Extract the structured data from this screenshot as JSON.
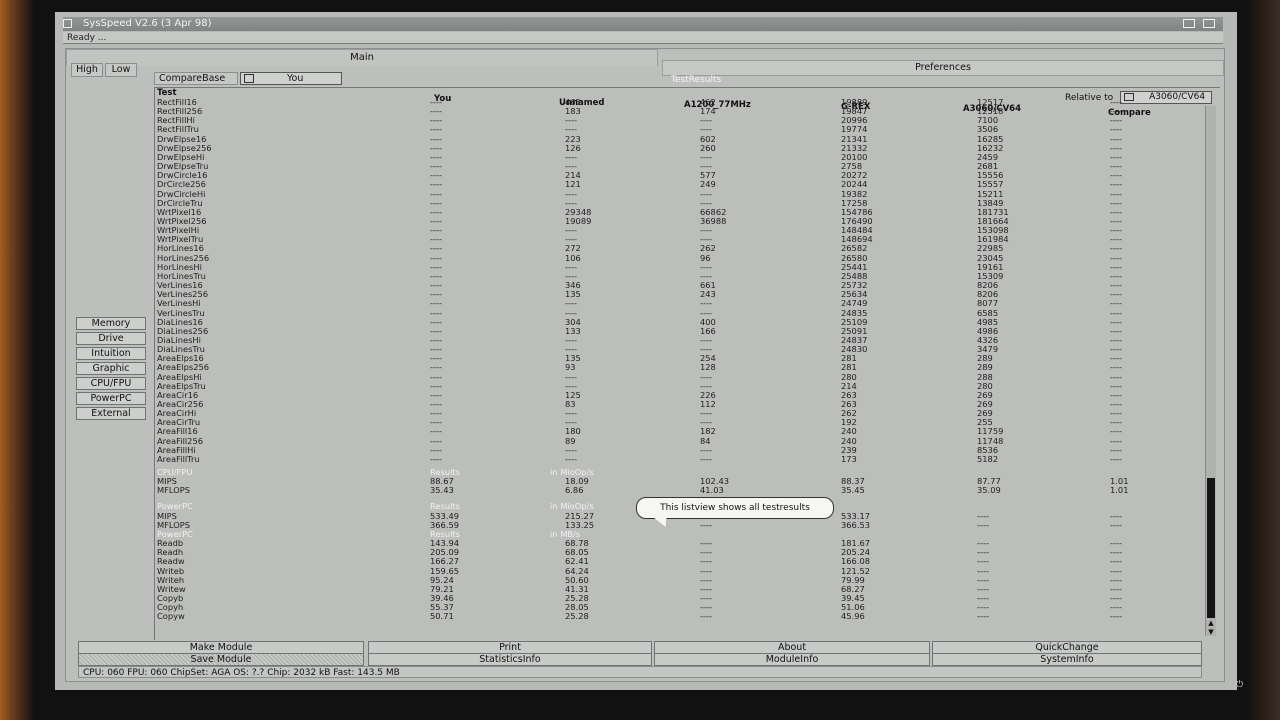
{
  "app": {
    "title": "SysSpeed  V2.6 (3 Apr 98)",
    "status_top": "Ready ...",
    "tabs": {
      "main": "Main",
      "preferences": "Preferences"
    },
    "res_tabs": [
      "High",
      "Low"
    ],
    "side_menu": [
      "Memory",
      "Drive",
      "Intuition",
      "Graphic",
      "CPU/FPU",
      "PowerPC",
      "External"
    ],
    "compare_base_label": "CompareBase",
    "compare_base_value": "You",
    "testresults_label": "TestResults",
    "relative_to_label": "Relative to",
    "relative_to_value": "A3060/CV64",
    "tooltip": "This listview shows all testresults",
    "bottom_buttons_row1": [
      "Make Module",
      "Print",
      "About",
      "QuickChange"
    ],
    "bottom_buttons_row2": [
      "Save Module",
      "StatisticsInfo",
      "ModuleInfo",
      "SystemInfo"
    ],
    "statusbar": "CPU: 060  FPU: 060  ChipSet: AGA  OS: ?.?  Chip: 2032 kB  Fast: 143.5 MB"
  },
  "table": {
    "headers": {
      "test": "Test",
      "c1": "You",
      "c2": "Unnamed",
      "c3": "A1200_77MHz",
      "c4": "G-REX",
      "c5": "A3060/CV64",
      "c6": "Compare"
    },
    "rows": [
      [
        "RectFill16",
        "----",
        "465",
        "462",
        "19889",
        "12517",
        "----"
      ],
      [
        "RectFill256",
        "----",
        "183",
        "174",
        "19847",
        "12518",
        "----"
      ],
      [
        "RectFillHi",
        "----",
        "----",
        "----",
        "20996",
        "7100",
        "----"
      ],
      [
        "RectFillTru",
        "----",
        "----",
        "----",
        "19774",
        "3506",
        "----"
      ],
      [
        "DrwElpse16",
        "----",
        "223",
        "602",
        "21341",
        "16285",
        "----"
      ],
      [
        "DrwElpse256",
        "----",
        "126",
        "260",
        "21332",
        "16232",
        "----"
      ],
      [
        "DrwElpseHi",
        "----",
        "----",
        "----",
        "20100",
        "2459",
        "----"
      ],
      [
        "DrwElpseTru",
        "----",
        "----",
        "----",
        "2758",
        "2681",
        "----"
      ],
      [
        "DrwCircle16",
        "----",
        "214",
        "577",
        "20272",
        "15556",
        "----"
      ],
      [
        "DrCircle256",
        "----",
        "121",
        "249",
        "20244",
        "15557",
        "----"
      ],
      [
        "DrwCircleHi",
        "----",
        "----",
        "----",
        "19382",
        "15211",
        "----"
      ],
      [
        "DrCircleTru",
        "----",
        "----",
        "----",
        "17258",
        "13849",
        "----"
      ],
      [
        "WrtPixel16",
        "----",
        "29348",
        "66862",
        "154786",
        "181731",
        "----"
      ],
      [
        "WrtPixel256",
        "----",
        "19089",
        "36988",
        "176490",
        "181664",
        "----"
      ],
      [
        "WrtPixelHi",
        "----",
        "----",
        "----",
        "148484",
        "153098",
        "----"
      ],
      [
        "WrtPixelTru",
        "----",
        "----",
        "----",
        "148694",
        "161984",
        "----"
      ],
      [
        "HorLines16",
        "----",
        "272",
        "262",
        "26582",
        "22985",
        "----"
      ],
      [
        "HorLines256",
        "----",
        "106",
        "96",
        "26580",
        "23045",
        "----"
      ],
      [
        "HorLinesHi",
        "----",
        "----",
        "----",
        "25441",
        "19161",
        "----"
      ],
      [
        "HorLinesTru",
        "----",
        "----",
        "----",
        "25488",
        "15309",
        "----"
      ],
      [
        "VerLines16",
        "----",
        "346",
        "661",
        "25732",
        "8206",
        "----"
      ],
      [
        "VerLines256",
        "----",
        "135",
        "243",
        "25634",
        "8206",
        "----"
      ],
      [
        "VerLinesHi",
        "----",
        "----",
        "----",
        "24749",
        "8077",
        "----"
      ],
      [
        "VerLinesTru",
        "----",
        "----",
        "----",
        "24835",
        "6585",
        "----"
      ],
      [
        "DiaLines16",
        "----",
        "304",
        "400",
        "25109",
        "4985",
        "----"
      ],
      [
        "DiaLines256",
        "----",
        "133",
        "166",
        "25091",
        "4986",
        "----"
      ],
      [
        "DiaLinesHi",
        "----",
        "----",
        "----",
        "24837",
        "4326",
        "----"
      ],
      [
        "DiaLinesTru",
        "----",
        "----",
        "----",
        "24830",
        "3479",
        "----"
      ],
      [
        "AreaElps16",
        "----",
        "135",
        "254",
        "281",
        "289",
        "----"
      ],
      [
        "AreaElps256",
        "----",
        "93",
        "128",
        "281",
        "289",
        "----"
      ],
      [
        "AreaElpsHi",
        "----",
        "----",
        "----",
        "280",
        "288",
        "----"
      ],
      [
        "AreaElpsTru",
        "----",
        "----",
        "----",
        "214",
        "280",
        "----"
      ],
      [
        "AreaCir16",
        "----",
        "125",
        "226",
        "263",
        "269",
        "----"
      ],
      [
        "AreaCir256",
        "----",
        "83",
        "112",
        "263",
        "269",
        "----"
      ],
      [
        "AreaCirHi",
        "----",
        "----",
        "----",
        "262",
        "269",
        "----"
      ],
      [
        "AreaCirTru",
        "----",
        "----",
        "----",
        "192",
        "255",
        "----"
      ],
      [
        "AreaFill16",
        "----",
        "180",
        "182",
        "240",
        "11759",
        "----"
      ],
      [
        "AreaFill256",
        "----",
        "89",
        "84",
        "240",
        "11748",
        "----"
      ],
      [
        "AreaFillHi",
        "----",
        "----",
        "----",
        "239",
        "8536",
        "----"
      ],
      [
        "AreaFillTru",
        "----",
        "----",
        "----",
        "173",
        "5182",
        "----"
      ]
    ],
    "sections": [
      {
        "title": "CPU/FPU",
        "results": "Results",
        "unit": "in MioOp/s",
        "rows": [
          [
            "MIPS",
            "88.67",
            "18.09",
            "102.43",
            "88.37",
            "87.77",
            "1.01"
          ],
          [
            "MFLOPS",
            "35.43",
            "6.86",
            "41.03",
            "35.45",
            "35.09",
            "1.01"
          ]
        ]
      },
      {
        "title": "PowerPC",
        "results": "Results",
        "unit": "in MioOp/s",
        "rows": [
          [
            "MIPS",
            "533.49",
            "215.27",
            "----",
            "533.17",
            "----",
            "----"
          ],
          [
            "MFLOPS",
            "366.59",
            "133.25",
            "----",
            "366.53",
            "----",
            "----"
          ]
        ]
      },
      {
        "title": "PowerPC",
        "results": "Results",
        "unit": "in MB/s",
        "rows": [
          [
            "Readb",
            "143.94",
            "68.78",
            "----",
            "181.67",
            "----",
            "----"
          ],
          [
            "Readh",
            "205.09",
            "68.05",
            "----",
            "205.24",
            "----",
            "----"
          ],
          [
            "Readw",
            "166.27",
            "62.41",
            "----",
            "166.08",
            "----",
            "----"
          ],
          [
            "Writeb",
            "159.65",
            "64.24",
            "----",
            "121.52",
            "----",
            "----"
          ],
          [
            "Writeh",
            "95.24",
            "50.60",
            "----",
            "79.99",
            "----",
            "----"
          ],
          [
            "Writew",
            "79.21",
            "41.31",
            "----",
            "68.27",
            "----",
            "----"
          ],
          [
            "Copyb",
            "39.46",
            "25.28",
            "----",
            "39.45",
            "----",
            "----"
          ],
          [
            "Copyh",
            "55.37",
            "28.05",
            "----",
            "51.06",
            "----",
            "----"
          ],
          [
            "Copyw",
            "50.71",
            "25.28",
            "----",
            "45.96",
            "----",
            "----"
          ]
        ]
      }
    ]
  }
}
